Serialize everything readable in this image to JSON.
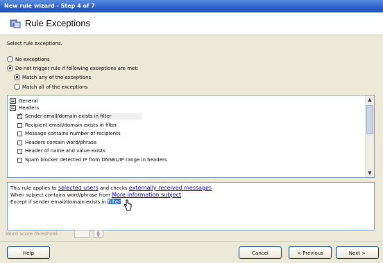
{
  "window": {
    "title": "New rule wizard - Step 4 of 7"
  },
  "header": {
    "title": "Rule Exceptions",
    "icon": "wizard-icon"
  },
  "instructions": "Select rule exceptions.",
  "options": {
    "no_exceptions": "No exceptions",
    "do_not_trigger": "Do not trigger rule if following exceptions are met:",
    "match_any": "Match any of the exceptions",
    "match_all": "Match all of the exceptions"
  },
  "list": {
    "group_general": "General",
    "group_headers": "Headers",
    "items": [
      {
        "label": "Sender email/domain exists in filter",
        "checked": true
      },
      {
        "label": "Recipient email/domain exists in filter",
        "checked": false
      },
      {
        "label": "Message contains number of recipients",
        "checked": false
      },
      {
        "label": "Headers contain word/phrase",
        "checked": false
      },
      {
        "label": "Header of name and value exists",
        "checked": false
      },
      {
        "label": "Spam blocker detected IP from DNSBL/IP range in headers",
        "checked": false
      }
    ]
  },
  "description": {
    "line1_prefix": "This rule applies to",
    "line1_link1": "selected users",
    "line1_mid": "and checks",
    "line1_link2": "externally received messages",
    "line2_prefix": "When subject contains word/phrase from",
    "line2_link": "More information subject",
    "line3_prefix": "Except if sender email/domain exists in",
    "line3_link": "filter"
  },
  "threshold": {
    "label": "Word score threshold:",
    "value": ""
  },
  "buttons": {
    "help": "Help",
    "cancel": "Cancel",
    "previous": "< Previous",
    "next": "Next >"
  }
}
